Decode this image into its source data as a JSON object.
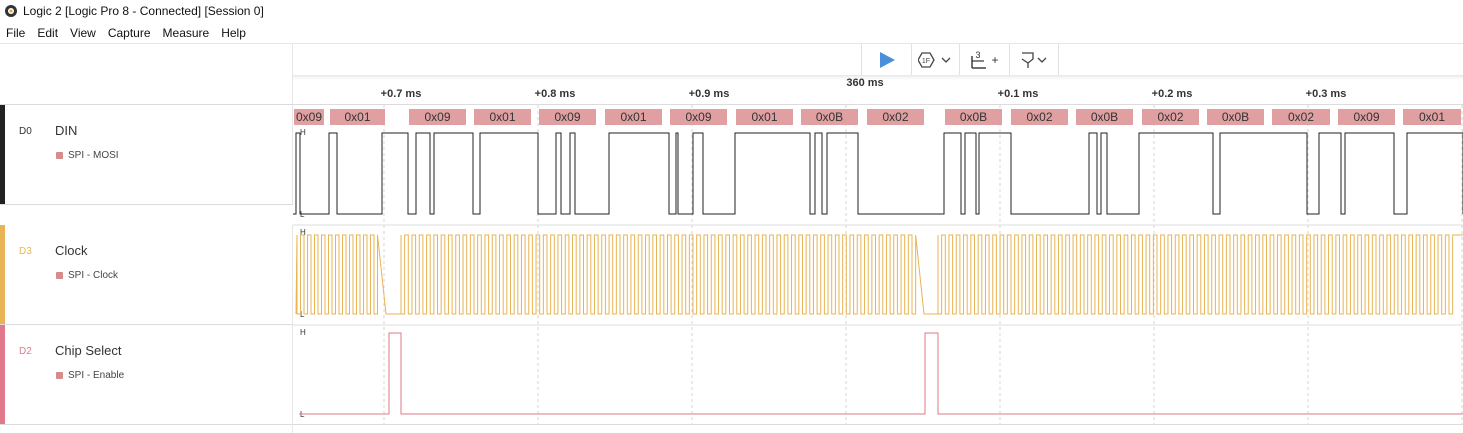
{
  "window": {
    "title": "Logic 2 [Logic Pro 8 - Connected] [Session 0]",
    "icon": "logic-app-icon"
  },
  "menu": [
    "File",
    "Edit",
    "View",
    "Capture",
    "Measure",
    "Help"
  ],
  "toolbar": {
    "play_icon": "play-icon",
    "trigger_icon": "trigger-settings-icon",
    "trigger_label": "1F",
    "measure_icon": "timing-marker-icon",
    "measure_count": "3",
    "measure_plus": "+",
    "flag_icon": "flag-icon",
    "accent": "#4a8fd9"
  },
  "ruler": {
    "ticks": [
      "+0.7 ms",
      "+0.8 ms",
      "+0.9 ms",
      "360 ms",
      "+0.1 ms",
      "+0.2 ms",
      "+0.3 ms"
    ]
  },
  "channels": [
    {
      "id": "D0",
      "name": "DIN",
      "color": "#222222",
      "id_color": "#333333",
      "analyzer": "SPI - MOSI",
      "analyzer_color": "#d98a8d",
      "high_label": "H",
      "low_label": "L"
    },
    {
      "id": "D3",
      "name": "Clock",
      "color": "#e8b455",
      "id_color": "#e8b455",
      "analyzer": "SPI - Clock",
      "analyzer_color": "#d98a8d",
      "high_label": "H",
      "low_label": "L"
    },
    {
      "id": "D2",
      "name": "Chip Select",
      "color": "#e07a8a",
      "id_color": "#e07a8a",
      "analyzer": "SPI - Enable",
      "analyzer_color": "#d98a8d",
      "high_label": "H",
      "low_label": "L"
    }
  ],
  "decoded_frames": [
    "0x09",
    "0x01",
    "0x09",
    "0x01",
    "0x09",
    "0x01",
    "0x09",
    "0x01",
    "0x0B",
    "0x02",
    "0x0B",
    "0x02",
    "0x0B",
    "0x02",
    "0x0B",
    "0x02",
    "0x09",
    "0x01"
  ],
  "frame_color": "#e0a0a2"
}
